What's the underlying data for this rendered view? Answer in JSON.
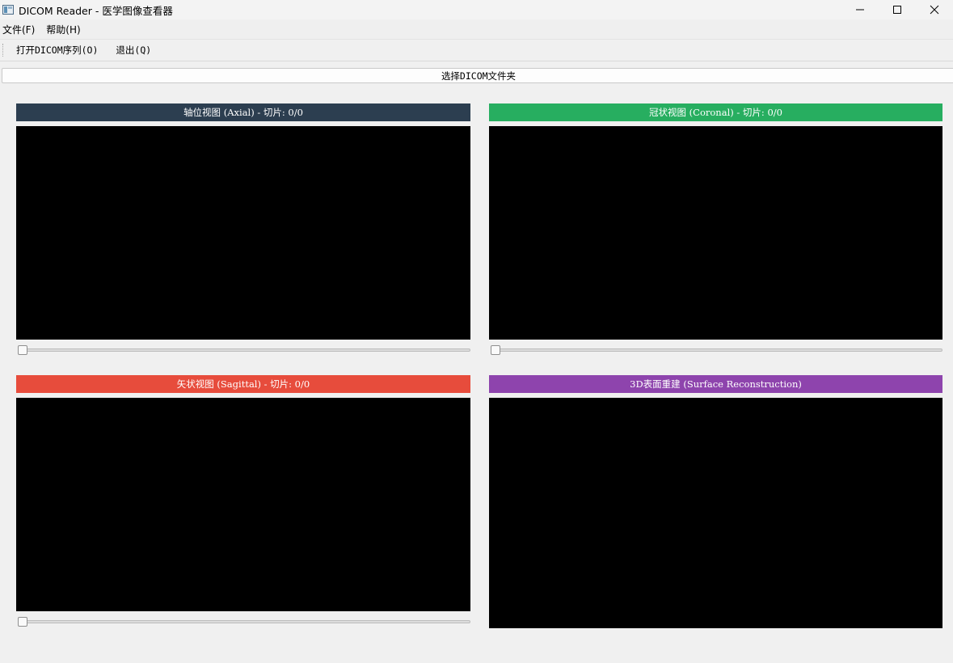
{
  "window": {
    "title": "DICOM Reader - 医学图像查看器",
    "app_icon": "app-window-icon",
    "controls": [
      "minimize-icon",
      "maximize-icon",
      "close-icon"
    ]
  },
  "menubar": {
    "items": [
      {
        "label": "文件(F)"
      },
      {
        "label": "帮助(H)"
      }
    ]
  },
  "toolbar": {
    "open_label": "打开DICOM序列(O)",
    "exit_label": "退出(Q)"
  },
  "select_folder_button": {
    "label": "选择DICOM文件夹"
  },
  "views": {
    "axial": {
      "header": "轴位视图 (Axial) - 切片: 0/0",
      "color": "#2c3e50",
      "slider_value": 0
    },
    "coronal": {
      "header": "冠状视图 (Coronal) - 切片: 0/0",
      "color": "#27ae60",
      "slider_value": 0
    },
    "sagittal": {
      "header": "矢状视图 (Sagittal) - 切片: 0/0",
      "color": "#e74c3c",
      "slider_value": 0
    },
    "surface": {
      "header": "3D表面重建 (Surface Reconstruction)",
      "color": "#8e44ad"
    }
  }
}
